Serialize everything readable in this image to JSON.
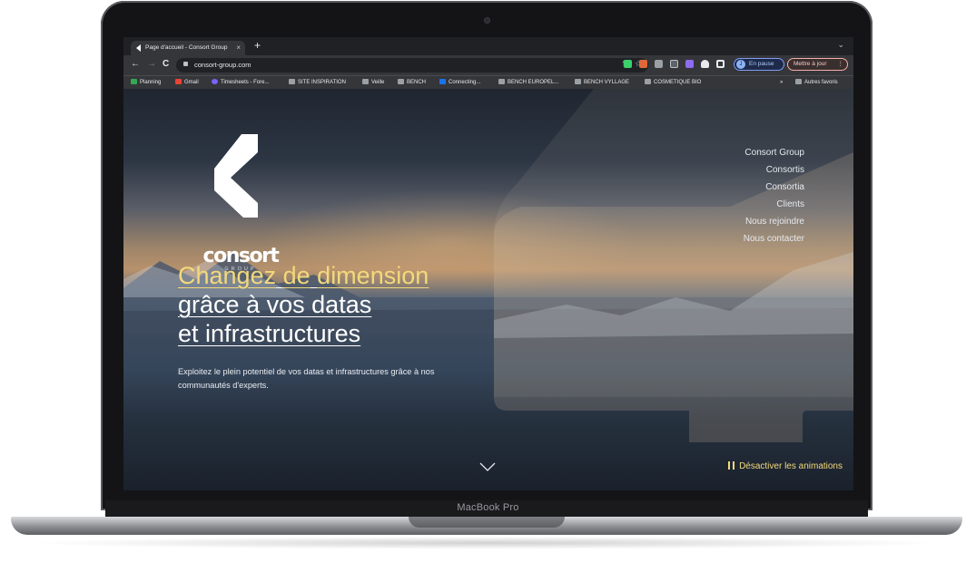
{
  "device": {
    "label": "MacBook Pro"
  },
  "browser": {
    "tab": {
      "title": "Page d'accueil - Consort Group",
      "close": "×"
    },
    "new_tab": "+",
    "tab_menu": "⌄",
    "nav": {
      "back": "←",
      "forward": "→",
      "reload": "C"
    },
    "url": "consort-group.com",
    "omnibox_icons": {
      "share": "⇪",
      "bookmark_star": "☆"
    },
    "profile": {
      "initial": "J",
      "label": "En pause"
    },
    "update_label": "Mettre à jour",
    "menu_dots": "⋮",
    "bookmarks": [
      "Planning",
      "Gmail",
      "Timesheets - Fore...",
      "SITE INSPIRATION",
      "Veille",
      "BENCH",
      "Connecting...",
      "BENCH EUROPEL...",
      "BENCH VYLLAGE",
      "COSMETIQUE BIO"
    ],
    "bookmarks_overflow": "»",
    "other_bookmarks": "Autres favoris"
  },
  "site": {
    "logo": {
      "wordmark": "consort",
      "sub": "GROUP"
    },
    "nav": [
      "Consort Group",
      "Consortis",
      "Consortia",
      "Clients",
      "Nous rejoindre",
      "Nous contacter"
    ],
    "hero": {
      "words": {
        "w1": "Changez",
        "w2": "de",
        "w3": "dimension",
        "w4": "grâce",
        "w5": "à",
        "w6": "vos",
        "w7": "datas",
        "w8": "et",
        "w9": "infrastructures"
      },
      "subtitle": "Exploitez le plein potentiel de vos datas et infrastructures grâce à nos communautés d'experts."
    },
    "animations_toggle": "Désactiver les animations"
  },
  "colors": {
    "accent": "#f3d97a",
    "chrome_dark": "#202124",
    "chrome": "#35363a"
  }
}
